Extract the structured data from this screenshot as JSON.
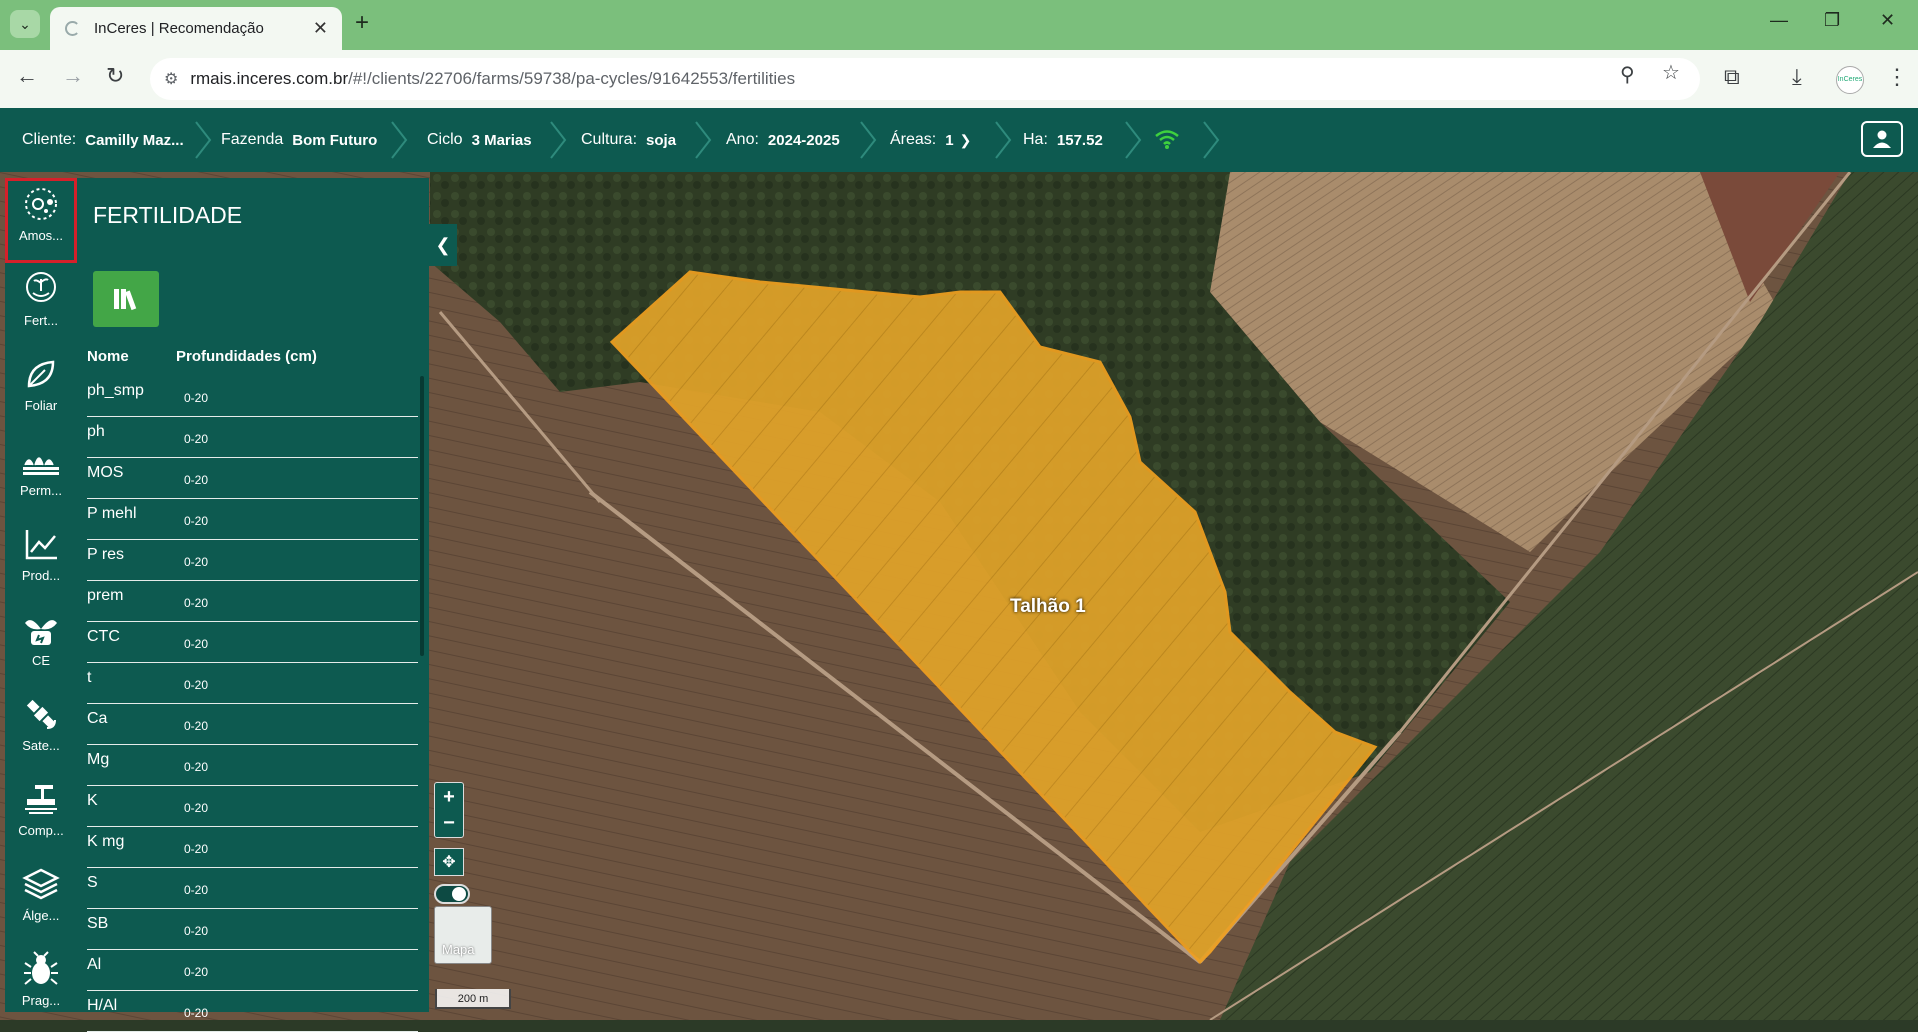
{
  "browser": {
    "tab_title": "InCeres | Recomendação",
    "url_host": "rmais.inceres.com.br",
    "url_path": "/#!/clients/22706/farms/59738/pa-cycles/91642553/fertilities",
    "profile_label": "InCeres"
  },
  "nav": {
    "cliente_label": "Cliente:",
    "cliente_value": "Camilly Maz...",
    "fazenda_label": "Fazenda",
    "fazenda_value": "Bom Futuro",
    "ciclo_label": "Ciclo",
    "ciclo_value": "3 Marias",
    "cultura_label": "Cultura:",
    "cultura_value": "soja",
    "ano_label": "Ano:",
    "ano_value": "2024-2025",
    "areas_label": "Áreas:",
    "areas_value": "1",
    "ha_label": "Ha:",
    "ha_value": "157.52"
  },
  "rail": [
    {
      "label": "Amos...",
      "icon": "sampling-icon"
    },
    {
      "label": "Fert...",
      "icon": "fertility-icon"
    },
    {
      "label": "Foliar",
      "icon": "leaf-icon"
    },
    {
      "label": "Perm...",
      "icon": "plants-icon"
    },
    {
      "label": "Prod...",
      "icon": "chart-line-icon"
    },
    {
      "label": "CE",
      "icon": "plug-leaf-icon"
    },
    {
      "label": "Sate...",
      "icon": "satellite-icon"
    },
    {
      "label": "Comp...",
      "icon": "tractor-icon"
    },
    {
      "label": "Álge...",
      "icon": "layers-icon"
    },
    {
      "label": "Prag...",
      "icon": "bug-icon"
    }
  ],
  "panel": {
    "title": "FERTILIDADE",
    "col_name": "Nome",
    "col_depth": "Profundidades (cm)",
    "rows": [
      {
        "name": "ph_smp",
        "depth": "0-20"
      },
      {
        "name": "ph",
        "depth": "0-20"
      },
      {
        "name": "MOS",
        "depth": "0-20"
      },
      {
        "name": "P mehl",
        "depth": "0-20"
      },
      {
        "name": "P res",
        "depth": "0-20"
      },
      {
        "name": "prem",
        "depth": "0-20"
      },
      {
        "name": "CTC",
        "depth": "0-20"
      },
      {
        "name": "t",
        "depth": "0-20"
      },
      {
        "name": "Ca",
        "depth": "0-20"
      },
      {
        "name": "Mg",
        "depth": "0-20"
      },
      {
        "name": "K",
        "depth": "0-20"
      },
      {
        "name": "K mg",
        "depth": "0-20"
      },
      {
        "name": "S",
        "depth": "0-20"
      },
      {
        "name": "SB",
        "depth": "0-20"
      },
      {
        "name": "Al",
        "depth": "0-20"
      },
      {
        "name": "H/Al",
        "depth": "0-20"
      }
    ]
  },
  "map": {
    "field_label": "Talhão 1",
    "basemap_label": "Mapa",
    "scale_label": "200 m",
    "zoom_in": "+",
    "zoom_out": "−"
  },
  "colors": {
    "brand": "#0d5a50",
    "field": "#e2a429",
    "accent_green": "#43a647",
    "selection": "#d6202a"
  }
}
